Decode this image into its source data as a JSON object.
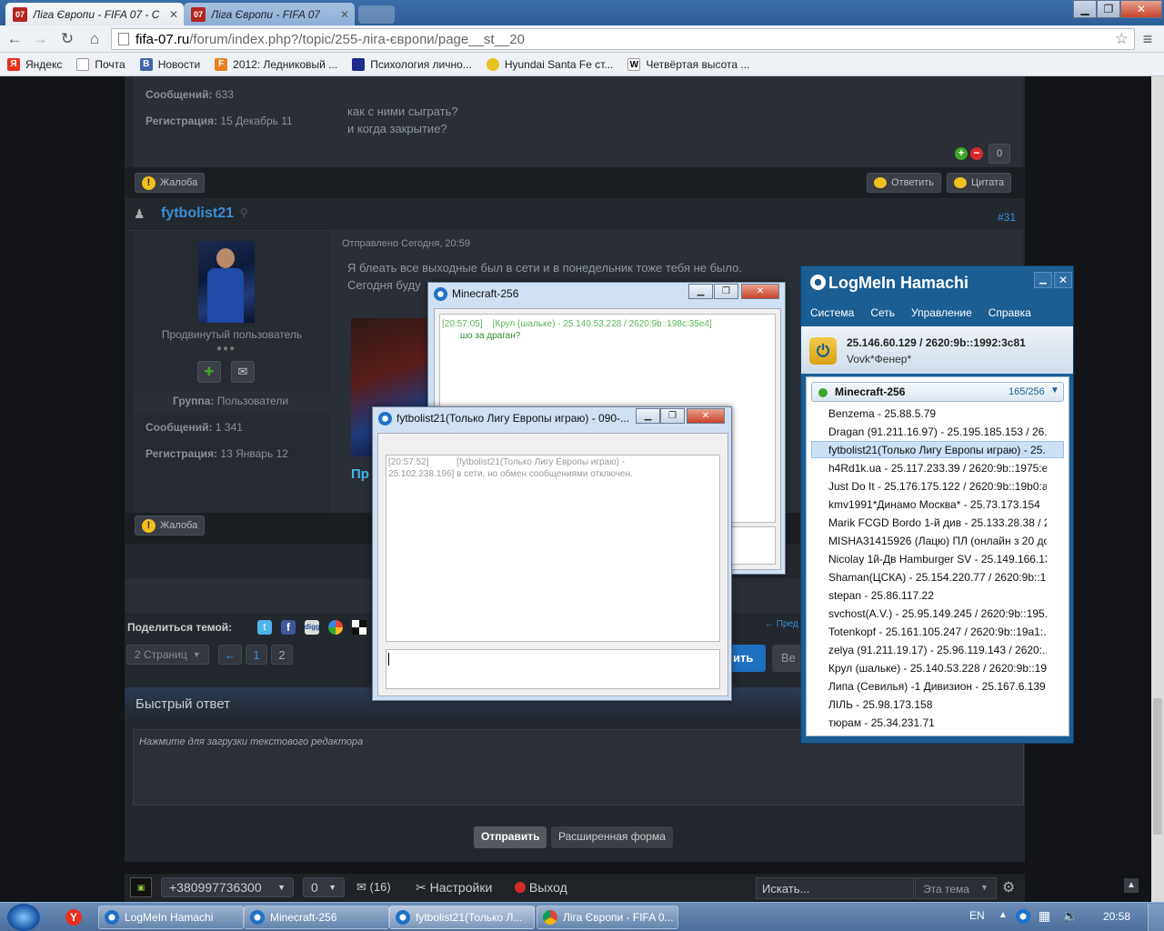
{
  "browser": {
    "tabs": [
      {
        "title": "Ліга Європи - FIFA 07 - С",
        "fav": "07"
      },
      {
        "title": "Ліга Європи - FIFA 07",
        "fav": "07"
      }
    ],
    "url_host": "fifa-07.ru",
    "url_path": "/forum/index.php?/topic/255-ліга-європи/page__st__20",
    "bookmarks": [
      {
        "label": "Яндекс",
        "icon_text": "Я",
        "color": "#e8301f"
      },
      {
        "label": "Почта",
        "icon_text": "",
        "color": "#ffffff"
      },
      {
        "label": "Новости",
        "icon_text": "В",
        "color": "#3f67a8"
      },
      {
        "label": "2012: Ледниковый ...",
        "icon_text": "F",
        "color": "#e8801f"
      },
      {
        "label": "Психология лично...",
        "icon_text": "",
        "color": "#1e2b8a"
      },
      {
        "label": "Hyundai Santa Fe ст...",
        "icon_text": "",
        "color": "#e8c31f"
      },
      {
        "label": "Четвёртая высота ...",
        "icon_text": "W",
        "color": "#ffffff"
      }
    ]
  },
  "post_prev": {
    "messages_label": "Сообщений",
    "messages_value": "633",
    "reg_label": "Регистрация",
    "reg_value": "15 Декабрь 11",
    "text1": "как с ними сыграть?",
    "text2": "и когда закрытие?",
    "rep": "0",
    "report": "Жалоба",
    "reply": "Ответить",
    "quote": "Цитата"
  },
  "post": {
    "author": "fytbolist21",
    "number": "#31",
    "sent": "Отправлено Сегодня, 20:59",
    "text1": "Я блеать все выходные был в сети и в понедельник тоже тебя не было.",
    "text2": "Сегодня буду",
    "rank": "Продвинутый пользователь",
    "group_label": "Группа",
    "group_value": "Пользователи",
    "messages_label": "Сообщений",
    "messages_value": "1 341",
    "reg_label": "Регистрация",
    "reg_value": "13 Январь 12",
    "sig_text": "Пр",
    "report": "Жалоба"
  },
  "share": {
    "label": "Поделиться темой:",
    "prev": "← Пред"
  },
  "pager": {
    "pages": "2 Страниц",
    "prev": "←",
    "p1": "1",
    "p2": "2",
    "reply_cut": "ить",
    "ve_cut": "Ве"
  },
  "quick": {
    "title": "Быстрый ответ",
    "placeholder": "Нажмите для загрузки текстового редактора",
    "send": "Отправить",
    "advanced": "Расширенная форма"
  },
  "bottombar": {
    "phone": "+380997736300",
    "zero": "0",
    "msgs": "(16)",
    "settings": "Настройки",
    "logout": "Выход",
    "search_ph": "Искать...",
    "scope": "Эта тема"
  },
  "mc_window": {
    "title": "Minecraft-256",
    "time": "[20:57:05]",
    "from": "[Крул (шальке) - 25.140.53.228 / 2620:9b::198c:35e4]",
    "msg": "шо за драган?"
  },
  "pm_window": {
    "title": "fytbolist21(Только Лигу Европы играю) - 090-...",
    "time": "[20:57:52]",
    "from": "[fytbolist21(Только Лигу Европы играю) -",
    "line2": "25.102.238.196] в сети, но обмен сообщениями отключен."
  },
  "hamachi": {
    "title": "LogMeIn Hamachi",
    "menu": [
      "Система",
      "Сеть",
      "Управление",
      "Справка"
    ],
    "ip": "25.146.60.129 / 2620:9b::1992:3c81",
    "nick": "Vovk*Фенер*",
    "network": "Minecraft-256",
    "count": "165/256",
    "peers": [
      "Benzema - 25.88.5.79",
      "Dragan (91.211.16.97) - 25.195.185.153 / 26...",
      "fytbolist21(Только Лигу Европы играю) - 25....",
      "h4Rd1k.ua - 25.117.233.39 / 2620:9b::1975:e...",
      "Just Do It - 25.176.175.122 / 2620:9b::19b0:a...",
      "kmv1991*Динамо Москва* - 25.73.173.154",
      "Marik   FCGD Bordo 1-й див - 25.133.28.38 / 2...",
      "MISHA31415926 (Лацю) ПЛ (онлайн з 20 до 2...",
      "Nicolay 1й-Дв Hamburger SV - 25.149.166.131",
      "Shaman(ЦСКА) - 25.154.220.77 / 2620:9b::19...",
      "stepan - 25.86.117.22",
      "svchost(A.V.) - 25.95.149.245 / 2620:9b::195...",
      "Totenkopf - 25.161.105.247 / 2620:9b::19a1:...",
      "zelya (91.211.19.17) - 25.96.119.143 / 2620:...",
      "Крул (шальке) - 25.140.53.228 / 2620:9b::19...",
      "Липа (Севилья) -1 Дивизион - 25.167.6.139 / ...",
      "ЛІЛЬ - 25.98.173.158",
      "тюрам - 25.34.231.71"
    ]
  },
  "taskbar": {
    "items": [
      "LogMeIn Hamachi",
      "Minecraft-256",
      "fytbolist21(Только Л...",
      "Ліга Європи - FIFA 0..."
    ],
    "lang": "EN",
    "clock": "20:58"
  }
}
